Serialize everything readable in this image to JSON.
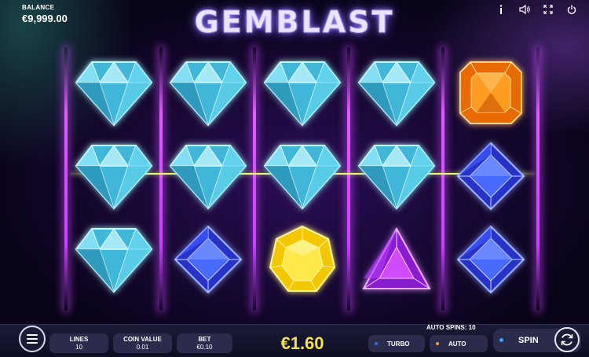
{
  "header": {
    "logo_text": "GEMBLAST",
    "balance_label": "BALANCE",
    "balance_value": "€9,999.00",
    "icons": [
      "info-icon",
      "sound-icon",
      "fullscreen-icon",
      "power-icon"
    ]
  },
  "reels": {
    "columns": 5,
    "rows": 3,
    "symbols": [
      [
        "cyan-diamond",
        "cyan-diamond",
        "cyan-diamond"
      ],
      [
        "cyan-diamond",
        "cyan-diamond",
        "blue-square-gem"
      ],
      [
        "cyan-diamond",
        "cyan-diamond",
        "yellow-heptagon-gem"
      ],
      [
        "cyan-diamond",
        "cyan-diamond",
        "purple-triangle-gem"
      ],
      [
        "orange-square-gem",
        "blue-square-gem",
        "blue-square-gem"
      ]
    ],
    "colors": {
      "cyan-diamond": "#7fe8ff",
      "blue-square-gem": "#3b56ff",
      "yellow-heptagon-gem": "#ffe11a",
      "purple-triangle-gem": "#d24bff",
      "orange-square-gem": "#ff8a12",
      "reel_light": "#e05cff",
      "payline": "#f1ff6a"
    }
  },
  "controls": {
    "lines_label": "LINES",
    "lines_value": "10",
    "coin_value_label": "COIN VALUE",
    "coin_value": "0.01",
    "bet_label": "BET",
    "bet_value": "€0.10",
    "total_bet": "€1.60",
    "auto_spins_label": "AUTO SPINS: 10",
    "turbo_label": "TURBO",
    "auto_label": "AUTO",
    "spin_label": "SPIN",
    "turbo_dot_color": "#3a6bd8",
    "auto_dot_color": "#ff9a2a",
    "spin_dot_color": "#3da4ff",
    "total_bet_color": "#f2e04a"
  }
}
